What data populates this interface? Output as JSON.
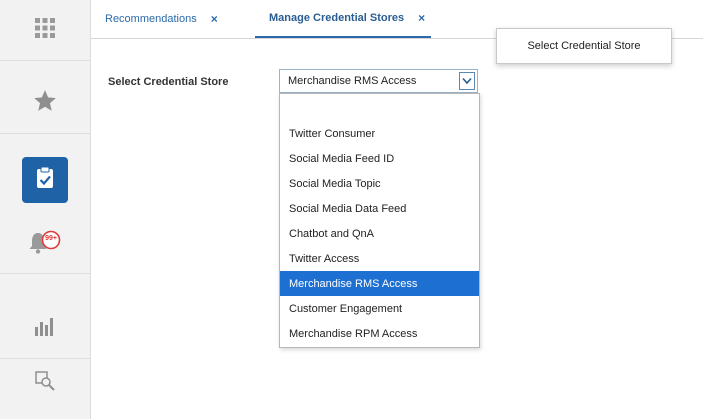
{
  "sidebar": {
    "items": [
      {
        "icon": "grid-icon"
      },
      {
        "icon": "star-icon"
      },
      {
        "icon": "tasks-icon"
      },
      {
        "icon": "notifications-icon",
        "badge": "99+"
      },
      {
        "icon": "reports-icon"
      },
      {
        "icon": "search-report-icon"
      }
    ]
  },
  "tabs": [
    {
      "label": "Recommendations",
      "close": "×"
    },
    {
      "label": "Manage Credential Stores",
      "close": "×"
    }
  ],
  "tooltip": "Select Credential Store",
  "form": {
    "label": "Select Credential Store",
    "selected_value": "Merchandise RMS Access"
  },
  "dropdown": {
    "options": [
      "",
      "Twitter Consumer",
      "Social Media Feed ID",
      "Social Media Topic",
      "Social Media Data Feed",
      "Chatbot and QnA",
      "Twitter Access",
      "Merchandise RMS Access",
      "Customer Engagement",
      "Merchandise RPM Access"
    ],
    "selected_index": 7
  },
  "colors": {
    "accent": "#1f63a6",
    "selection": "#1d6fd1",
    "tab_text": "#2a6aaa",
    "badge": "#e03a3a"
  }
}
